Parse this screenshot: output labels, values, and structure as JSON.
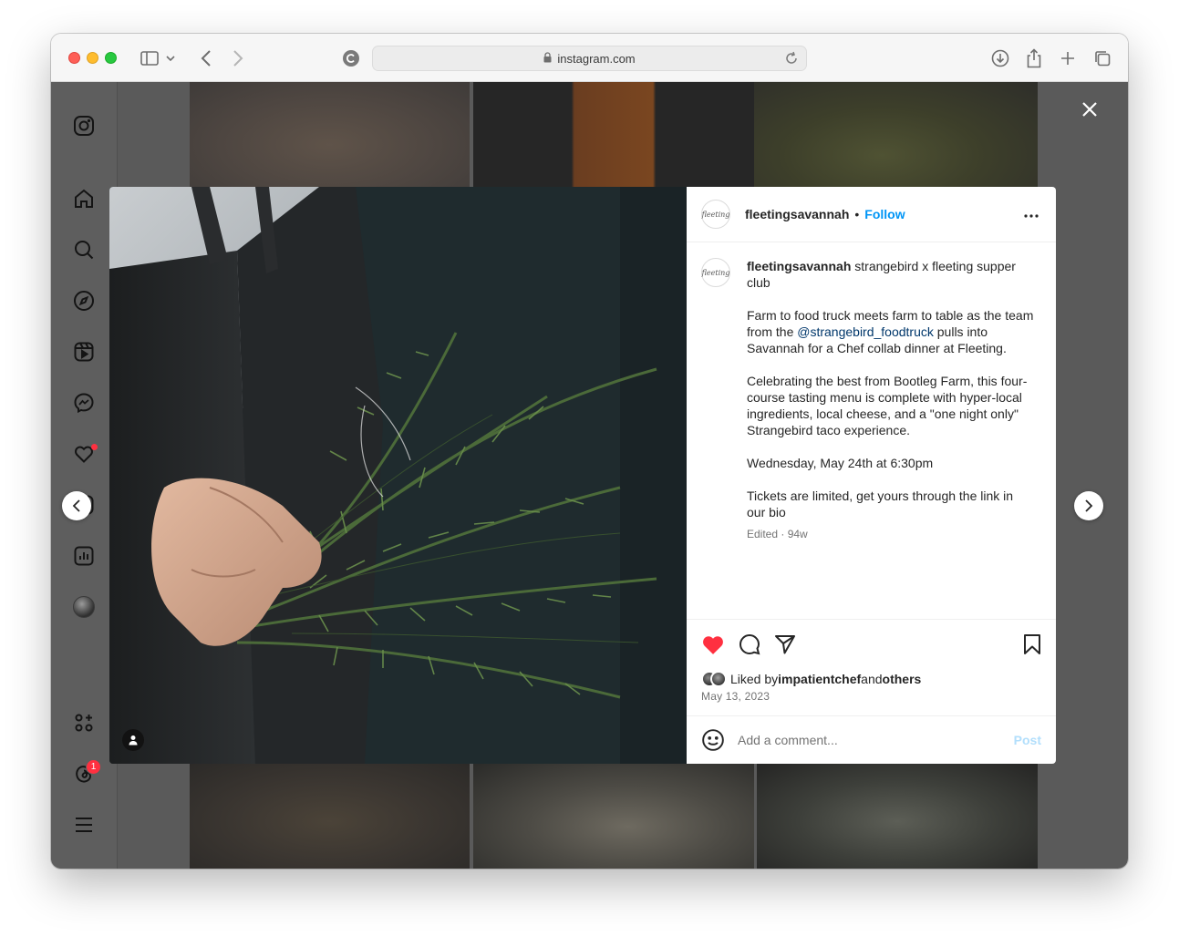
{
  "browser": {
    "url": "instagram.com"
  },
  "post": {
    "username": "fleetingsavannah",
    "follow_label": "Follow",
    "caption_headline": "strangebird x fleeting supper club",
    "caption_p1_before": "Farm to food truck meets farm to table as the team from the ",
    "caption_mention": "@strangebird_foodtruck",
    "caption_p1_after": " pulls into Savannah for a Chef collab dinner at Fleeting.",
    "caption_p2": "Celebrating the best from Bootleg Farm, this four-course tasting menu is complete with hyper-local ingredients, local cheese, and a \"one night only\" Strangebird taco experience.",
    "caption_p3": "Wednesday, May 24th at 6:30pm",
    "caption_p4": "Tickets are limited, get yours through the link in our bio",
    "meta": "Edited · 94w",
    "liked_prefix": "Liked by ",
    "liked_user": "impatientchef",
    "liked_mid": " and ",
    "liked_others": "others",
    "date": "May 13, 2023",
    "comment_placeholder": "Add a comment...",
    "post_label": "Post",
    "liked": true
  },
  "sidebar": {
    "notification_badge": "1"
  },
  "colors": {
    "accent": "#0095f6",
    "like": "#ff3040",
    "mention": "#00376b"
  }
}
